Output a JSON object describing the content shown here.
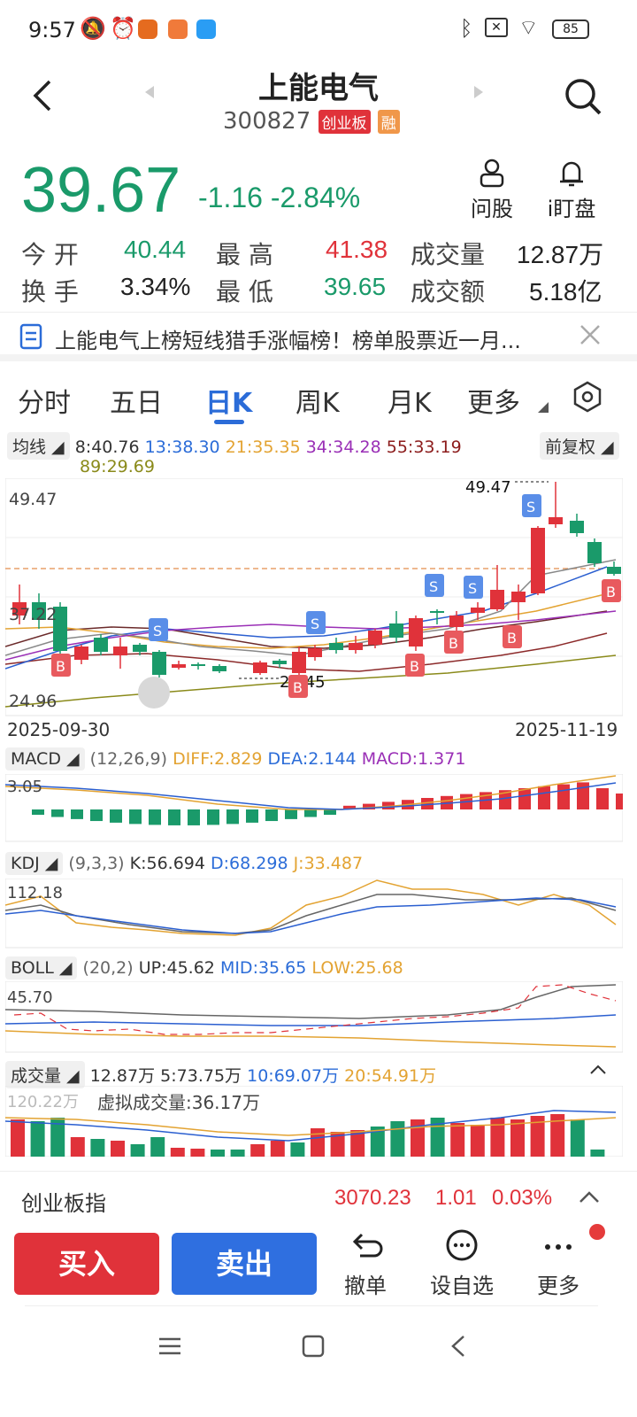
{
  "status": {
    "time": "9:57",
    "battery": "85"
  },
  "header": {
    "title": "上能电气",
    "code": "300827",
    "board_tag": "创业板",
    "margin_tag": "融"
  },
  "quote": {
    "price": "39.67",
    "change": "-1.16",
    "change_pct": "-2.84%"
  },
  "actions_top": {
    "ask": "问股",
    "watch": "i盯盘"
  },
  "stats": {
    "open_label": "今  开",
    "open": "40.44",
    "high_label": "最  高",
    "high": "41.38",
    "volume_label": "成交量",
    "volume": "12.87万",
    "turnover_label": "换  手",
    "turnover": "3.34%",
    "low_label": "最  低",
    "low": "39.65",
    "amount_label": "成交额",
    "amount": "5.18亿"
  },
  "news": {
    "text": "上能电气上榜短线猎手涨幅榜！榜单股票近一月..."
  },
  "tabs": [
    "分时",
    "五日",
    "日K",
    "周K",
    "月K",
    "更多"
  ],
  "active_tab": "日K",
  "ma_legend": {
    "label": "均线",
    "ma8": "8:40.76",
    "ma13": "13:38.30",
    "ma21": "21:35.35",
    "ma34": "34:34.28",
    "ma55": "55:33.19",
    "ma89": "89:29.69",
    "adjust": "前复权"
  },
  "kline": {
    "y_top": "49.47",
    "y_mid": "37.22",
    "y_bottom": "24.96",
    "date_start": "2025-09-30",
    "date_end": "2025-11-19",
    "high_marker": "49.47",
    "low_marker": "28.45"
  },
  "macd": {
    "label": "MACD",
    "params": "(12,26,9)",
    "diff": "DIFF:2.829",
    "dea": "DEA:2.144",
    "macd": "MACD:1.371",
    "y_top": "3.05"
  },
  "kdj": {
    "label": "KDJ",
    "params": "(9,3,3)",
    "k": "K:56.694",
    "d": "D:68.298",
    "j": "J:33.487",
    "y_top": "112.18"
  },
  "boll": {
    "label": "BOLL",
    "params": "(20,2)",
    "up": "UP:45.62",
    "mid": "MID:35.65",
    "low": "LOW:25.68",
    "y_top": "45.70"
  },
  "vol": {
    "label": "成交量",
    "v": "12.87万",
    "ma5": "5:73.75万",
    "ma10": "10:69.07万",
    "ma20": "20:54.91万",
    "y_top": "120.22万",
    "virtual": "虚拟成交量:36.17万"
  },
  "index_bar": {
    "name": "创业板指",
    "value": "3070.23",
    "change": "1.01",
    "pct": "0.03%"
  },
  "bottom": {
    "buy": "买入",
    "sell": "卖出",
    "cancel": "撤单",
    "watchlist": "设自选",
    "more": "更多"
  },
  "colors": {
    "up": "#e0323a",
    "down": "#1a9a6a",
    "accent": "#2b6cd8"
  }
}
